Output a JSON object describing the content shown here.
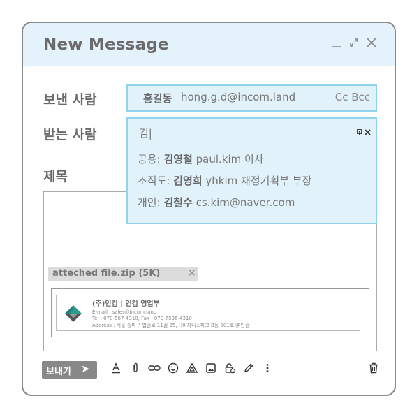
{
  "window": {
    "title": "New Message",
    "minimize_icon": "minimize-icon",
    "expand_icon": "expand-icon",
    "close_icon": "close-icon"
  },
  "labels": {
    "sender": "보낸 사람",
    "recipient": "받는 사람",
    "subject": "제목"
  },
  "sender": {
    "name": "홍길동",
    "email": "hong.g.d@incom.land",
    "cc_bcc": "Cc Bcc"
  },
  "recipient": {
    "input": "김|",
    "suggestions": [
      {
        "source": "공용: ",
        "name": "김영철",
        "detail": " paul.kim 이사"
      },
      {
        "source": "조직도: ",
        "name": "김영희",
        "detail": " yhkim 재정기획부 부장"
      },
      {
        "source": "개인: ",
        "name": "김철수",
        "detail": " cs.kim@naver.com"
      }
    ]
  },
  "attachment": {
    "name": "atteched file.zip (5K)",
    "remove": "×"
  },
  "signature": {
    "company": "(주)인컴   |   인컴 영업부",
    "email": "E-mail : sales@incom.land",
    "tel": "Tel : 070-567-4310, Fax : 070-7596-4310",
    "address": "Address : 서울 송파구 법원로 11길 25, H비지니스파크 B동 501호 ㈜인컴"
  },
  "toolbar": {
    "send_label": "보내기",
    "send_arrow": "➤",
    "icons": [
      "text-format-icon",
      "attach-icon",
      "link-icon",
      "emoji-icon",
      "drive-icon",
      "image-icon",
      "lock-icon",
      "pen-icon",
      "more-icon",
      "trash-icon"
    ]
  },
  "colors": {
    "header_bg": "#e4f3fb",
    "field_bg": "#e1f2fa",
    "field_border": "#8fd3ef",
    "send_button": "#888888",
    "logo_teal": "#2a9d8f"
  }
}
